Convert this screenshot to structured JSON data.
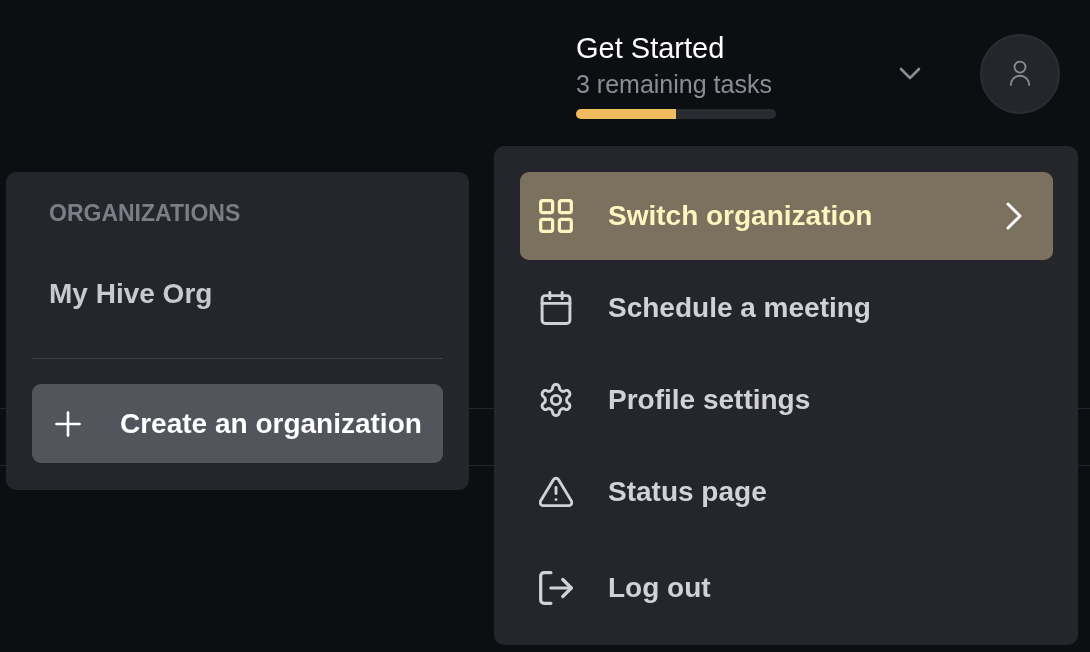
{
  "header": {
    "title": "Get Started",
    "subtitle": "3 remaining tasks",
    "progress": {
      "level": 0.5
    },
    "expanded": false
  },
  "organizations_panel": {
    "heading": "ORGANIZATIONS",
    "items": [
      {
        "label": "My Hive Org",
        "selected": false
      }
    ],
    "create_button": {
      "label": "Create an organization"
    }
  },
  "user_menu": {
    "items": [
      {
        "kind": "submenu",
        "label": "Switch organization",
        "selected": true
      },
      {
        "kind": "action",
        "label": "Schedule a meeting",
        "selected": false
      },
      {
        "kind": "action",
        "label": "Profile settings",
        "selected": false
      },
      {
        "kind": "action",
        "label": "Status page",
        "selected": false
      },
      {
        "kind": "action",
        "label": "Log out",
        "selected": false
      }
    ]
  }
}
